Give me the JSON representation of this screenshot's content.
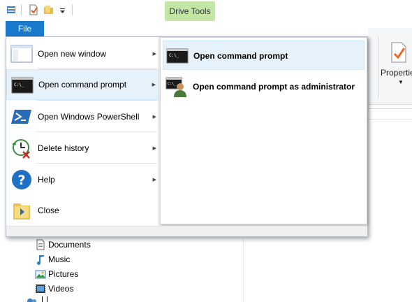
{
  "quick_access": {
    "icons": [
      "properties-icon",
      "new-folder-icon",
      "customize-dropdown-icon"
    ]
  },
  "ribbon": {
    "contextual_tab": "Drive Tools",
    "properties_label": "Propertie"
  },
  "file_tab": {
    "label": "File"
  },
  "file_menu": {
    "items": [
      {
        "label": "Open new window",
        "icon": "window-icon",
        "has_submenu": true
      },
      {
        "label": "Open command prompt",
        "icon": "command-prompt-icon",
        "has_submenu": true,
        "selected": true
      },
      {
        "label": "Open Windows PowerShell",
        "icon": "powershell-icon",
        "has_submenu": true
      },
      {
        "label": "Delete history",
        "icon": "delete-history-icon",
        "has_submenu": true
      },
      {
        "label": "Help",
        "icon": "help-icon",
        "has_submenu": true
      },
      {
        "label": "Close",
        "icon": "close-folder-icon",
        "has_submenu": false
      }
    ],
    "submenu": [
      {
        "label": "Open command prompt",
        "icon": "command-prompt-icon",
        "highlighted": true
      },
      {
        "label": "Open command prompt as administrator",
        "icon": "admin-command-prompt-icon",
        "highlighted": false
      }
    ]
  },
  "nav_tree": [
    {
      "label": "Documents",
      "icon": "documents-icon"
    },
    {
      "label": "Music",
      "icon": "music-icon"
    },
    {
      "label": "Pictures",
      "icon": "pictures-icon"
    },
    {
      "label": "Videos",
      "icon": "videos-icon"
    }
  ],
  "colors": {
    "file_tab": "#1979ca",
    "contextual_tab": "#c3e6a7",
    "selection": "#e5f1fb"
  }
}
